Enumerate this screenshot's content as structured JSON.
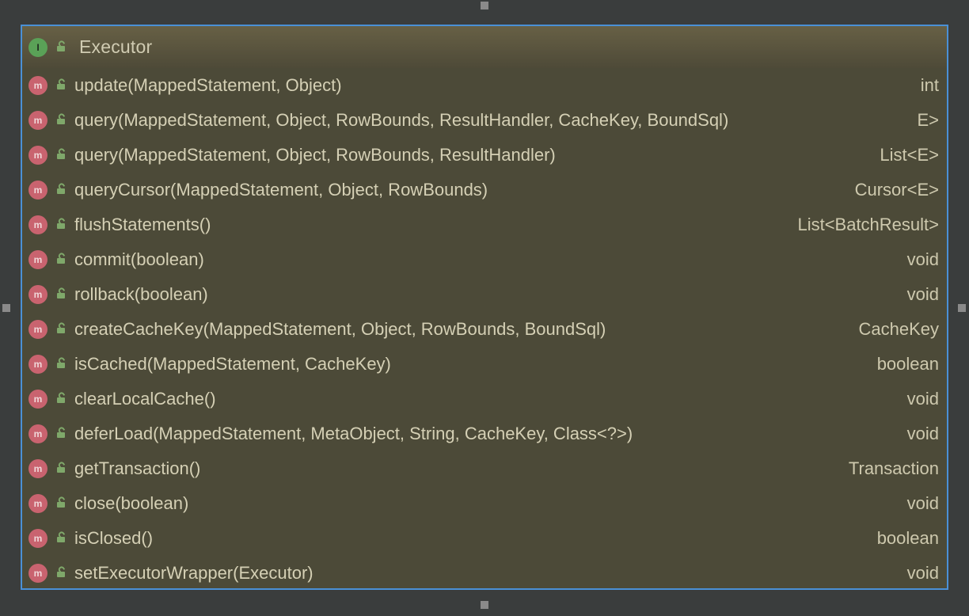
{
  "header": {
    "icon_letter": "I",
    "lock_state": "open",
    "title": "Executor"
  },
  "method_icon_letter": "m",
  "methods": [
    {
      "signature": "update(MappedStatement, Object)",
      "return": "int"
    },
    {
      "signature": "query(MappedStatement, Object, RowBounds, ResultHandler, CacheKey, BoundSql)",
      "return": "E>"
    },
    {
      "signature": "query(MappedStatement, Object, RowBounds, ResultHandler)",
      "return": "List<E>"
    },
    {
      "signature": "queryCursor(MappedStatement, Object, RowBounds)",
      "return": "Cursor<E>"
    },
    {
      "signature": "flushStatements()",
      "return": "List<BatchResult>"
    },
    {
      "signature": "commit(boolean)",
      "return": "void"
    },
    {
      "signature": "rollback(boolean)",
      "return": "void"
    },
    {
      "signature": "createCacheKey(MappedStatement, Object, RowBounds, BoundSql)",
      "return": "CacheKey"
    },
    {
      "signature": "isCached(MappedStatement, CacheKey)",
      "return": "boolean"
    },
    {
      "signature": "clearLocalCache()",
      "return": "void"
    },
    {
      "signature": "deferLoad(MappedStatement, MetaObject, String, CacheKey, Class<?>)",
      "return": "void"
    },
    {
      "signature": "getTransaction()",
      "return": "Transaction"
    },
    {
      "signature": "close(boolean)",
      "return": "void"
    },
    {
      "signature": "isClosed()",
      "return": "boolean"
    },
    {
      "signature": "setExecutorWrapper(Executor)",
      "return": "void"
    }
  ]
}
